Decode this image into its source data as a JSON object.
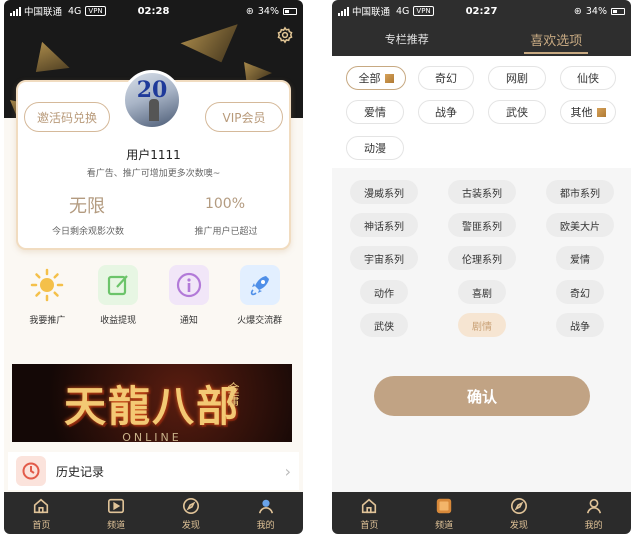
{
  "left": {
    "status": {
      "carrier": "中国联通",
      "network": "4G",
      "vpn": "VPN",
      "time": "02:28",
      "battery": "34%"
    },
    "profile": {
      "invite_button": "邀活码兑换",
      "vip_button": "VIP会员",
      "username": "用户1111",
      "tip": "看广告、推广可增加更多次数噢~",
      "stats": [
        {
          "value": "无限",
          "label": "今日剩余观影次数"
        },
        {
          "value": "100%",
          "label": "推广用户已超过"
        }
      ]
    },
    "quick_actions": [
      {
        "label": "我要推广",
        "icon": "sun-icon"
      },
      {
        "label": "收益提现",
        "icon": "edit-icon"
      },
      {
        "label": "通知",
        "icon": "info-icon"
      },
      {
        "label": "火爆交流群",
        "icon": "rocket-icon"
      }
    ],
    "banner": {
      "title": "天龍八部",
      "badge": "金庸",
      "subtitle": "ONLINE"
    },
    "history": {
      "title": "历史记录"
    },
    "tabs": [
      {
        "label": "首页",
        "icon": "home-icon"
      },
      {
        "label": "频道",
        "icon": "play-icon"
      },
      {
        "label": "发现",
        "icon": "compass-icon"
      },
      {
        "label": "我的",
        "icon": "user-icon"
      }
    ]
  },
  "right": {
    "status": {
      "carrier": "中国联通",
      "network": "4G",
      "vpn": "VPN",
      "time": "02:27",
      "battery": "34%"
    },
    "header_tabs": [
      {
        "label": "专栏推荐"
      },
      {
        "label": "喜欢选项"
      }
    ],
    "favorites": [
      "全部",
      "奇幻",
      "网剧",
      "仙侠",
      "爱情",
      "战争",
      "武侠",
      "其他",
      "动漫"
    ],
    "categories": [
      "漫威系列",
      "古装系列",
      "都市系列",
      "神话系列",
      "警匪系列",
      "欧美大片",
      "宇宙系列",
      "伦理系列",
      "爱情",
      "动作",
      "喜剧",
      "奇幻",
      "武侠",
      "剧情",
      "战争"
    ],
    "selected_category": "剧情",
    "confirm": "确认",
    "tabs": [
      {
        "label": "首页",
        "icon": "home-icon"
      },
      {
        "label": "频道",
        "icon": "channel-icon"
      },
      {
        "label": "发现",
        "icon": "compass-icon"
      },
      {
        "label": "我的",
        "icon": "user-icon"
      }
    ],
    "accent": "#c1a384"
  }
}
